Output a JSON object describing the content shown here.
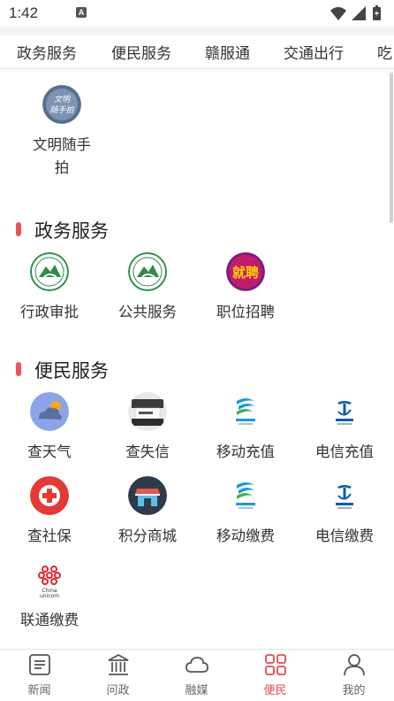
{
  "status_bar": {
    "time": "1:42",
    "notification": "A"
  },
  "top_tabs": [
    "政务服务",
    "便民服务",
    "赣服通",
    "交通出行",
    "吃"
  ],
  "featured": {
    "label": "文明随手拍",
    "icon_text": "文明随手拍"
  },
  "sections": {
    "gov": {
      "title": "政务服务",
      "items": [
        {
          "label": "行政审批",
          "icon": "gov-emblem-icon"
        },
        {
          "label": "公共服务",
          "icon": "gov-emblem-icon"
        },
        {
          "label": "职位招聘",
          "icon": "recruit-icon",
          "icon_text": "就聘"
        }
      ]
    },
    "convenience": {
      "title": "便民服务",
      "items": [
        {
          "label": "查天气",
          "icon": "weather-icon"
        },
        {
          "label": "查失信",
          "icon": "credit-icon"
        },
        {
          "label": "移动充值",
          "icon": "china-mobile-icon"
        },
        {
          "label": "电信充值",
          "icon": "china-telecom-icon"
        },
        {
          "label": "查社保",
          "icon": "social-security-icon"
        },
        {
          "label": "积分商城",
          "icon": "points-mall-icon"
        },
        {
          "label": "移动缴费",
          "icon": "china-mobile-icon"
        },
        {
          "label": "电信缴费",
          "icon": "china-telecom-icon"
        },
        {
          "label": "联通缴费",
          "icon": "china-unicom-icon",
          "icon_text": "China unicom"
        }
      ]
    }
  },
  "bottom_nav": [
    {
      "label": "新闻",
      "icon": "news-icon",
      "active": false
    },
    {
      "label": "问政",
      "icon": "government-building-icon",
      "active": false
    },
    {
      "label": "融媒",
      "icon": "cloud-icon",
      "active": false
    },
    {
      "label": "便民",
      "icon": "grid-icon",
      "active": true
    },
    {
      "label": "我的",
      "icon": "user-icon",
      "active": false
    }
  ],
  "colors": {
    "accent": "#e24a50",
    "section_bar": "#e9545a",
    "mobile_blue": "#1a9ad6",
    "telecom_blue": "#0b5cad"
  }
}
